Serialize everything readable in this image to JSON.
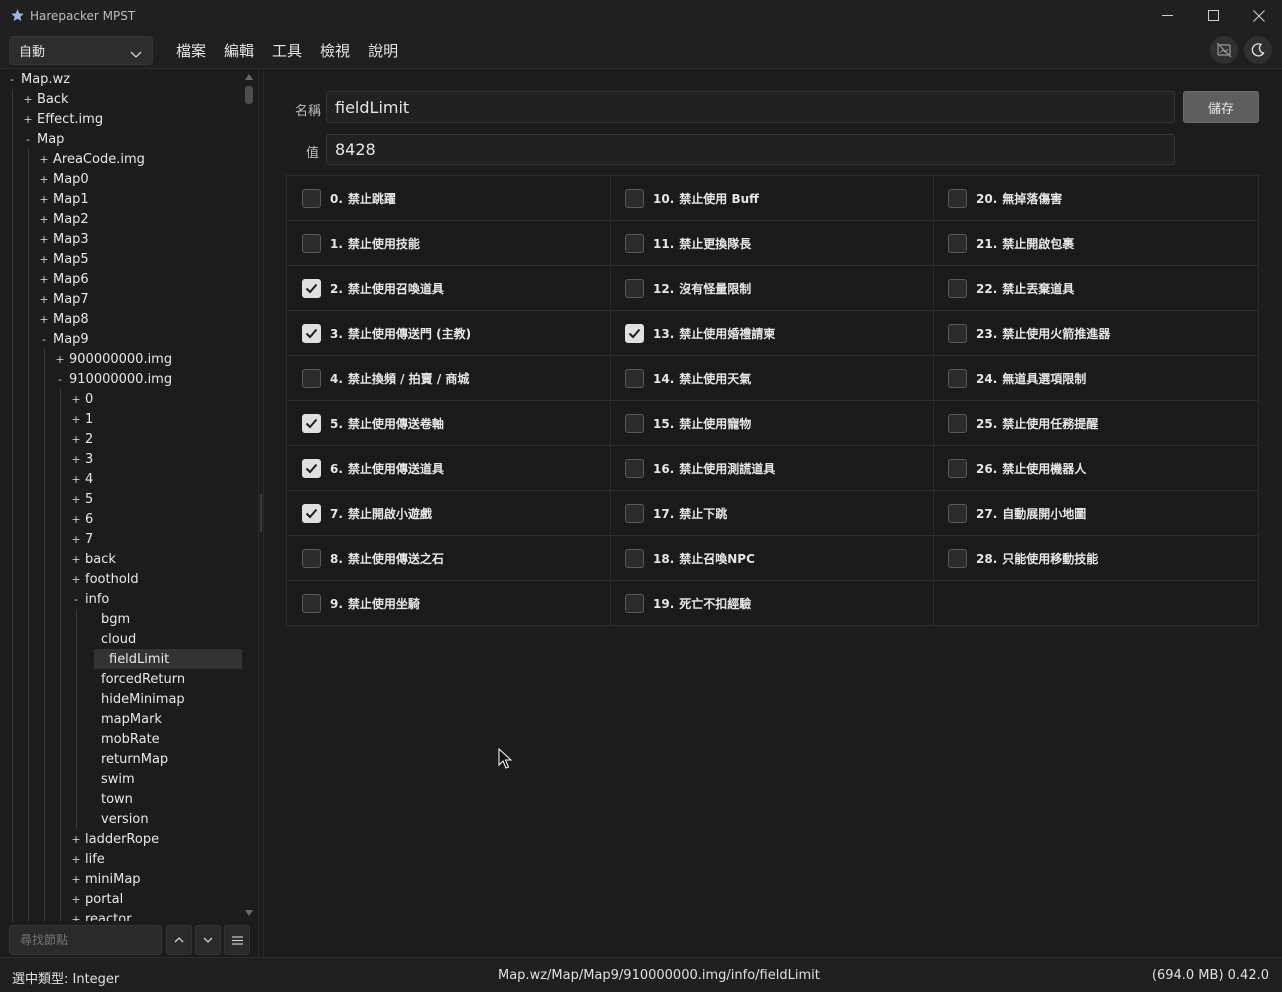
{
  "window": {
    "title": "Harepacker MPST",
    "minimize_icon": "minimize-icon",
    "maximize_icon": "maximize-icon",
    "close_icon": "close-icon"
  },
  "toolbar": {
    "mode_select": {
      "value": "自動"
    },
    "menus": [
      "檔案",
      "編輯",
      "工具",
      "檢視",
      "說明"
    ],
    "right_icons": [
      "image-off-icon",
      "moon-icon"
    ]
  },
  "tree": {
    "items": [
      {
        "label": "Map.wz",
        "expander": "-",
        "level": 0
      },
      {
        "label": "Back",
        "expander": "+",
        "level": 1
      },
      {
        "label": "Effect.img",
        "expander": "+",
        "level": 1
      },
      {
        "label": "Map",
        "expander": "-",
        "level": 1
      },
      {
        "label": "AreaCode.img",
        "expander": "+",
        "level": 2
      },
      {
        "label": "Map0",
        "expander": "+",
        "level": 2
      },
      {
        "label": "Map1",
        "expander": "+",
        "level": 2
      },
      {
        "label": "Map2",
        "expander": "+",
        "level": 2
      },
      {
        "label": "Map3",
        "expander": "+",
        "level": 2
      },
      {
        "label": "Map5",
        "expander": "+",
        "level": 2
      },
      {
        "label": "Map6",
        "expander": "+",
        "level": 2
      },
      {
        "label": "Map7",
        "expander": "+",
        "level": 2
      },
      {
        "label": "Map8",
        "expander": "+",
        "level": 2
      },
      {
        "label": "Map9",
        "expander": "-",
        "level": 2
      },
      {
        "label": "900000000.img",
        "expander": "+",
        "level": 3
      },
      {
        "label": "910000000.img",
        "expander": "-",
        "level": 3
      },
      {
        "label": "0",
        "expander": "+",
        "level": 4
      },
      {
        "label": "1",
        "expander": "+",
        "level": 4
      },
      {
        "label": "2",
        "expander": "+",
        "level": 4
      },
      {
        "label": "3",
        "expander": "+",
        "level": 4
      },
      {
        "label": "4",
        "expander": "+",
        "level": 4
      },
      {
        "label": "5",
        "expander": "+",
        "level": 4
      },
      {
        "label": "6",
        "expander": "+",
        "level": 4
      },
      {
        "label": "7",
        "expander": "+",
        "level": 4
      },
      {
        "label": "back",
        "expander": "+",
        "level": 4
      },
      {
        "label": "foothold",
        "expander": "+",
        "level": 4
      },
      {
        "label": "info",
        "expander": "-",
        "level": 4
      },
      {
        "label": "bgm",
        "expander": "",
        "level": 5
      },
      {
        "label": "cloud",
        "expander": "",
        "level": 5
      },
      {
        "label": "fieldLimit",
        "expander": "",
        "level": 5,
        "selected": true
      },
      {
        "label": "forcedReturn",
        "expander": "",
        "level": 5
      },
      {
        "label": "hideMinimap",
        "expander": "",
        "level": 5
      },
      {
        "label": "mapMark",
        "expander": "",
        "level": 5
      },
      {
        "label": "mobRate",
        "expander": "",
        "level": 5
      },
      {
        "label": "returnMap",
        "expander": "",
        "level": 5
      },
      {
        "label": "swim",
        "expander": "",
        "level": 5
      },
      {
        "label": "town",
        "expander": "",
        "level": 5
      },
      {
        "label": "version",
        "expander": "",
        "level": 5
      },
      {
        "label": "ladderRope",
        "expander": "+",
        "level": 4
      },
      {
        "label": "life",
        "expander": "+",
        "level": 4
      },
      {
        "label": "miniMap",
        "expander": "+",
        "level": 4
      },
      {
        "label": "portal",
        "expander": "+",
        "level": 4
      },
      {
        "label": "reactor",
        "expander": "+",
        "level": 4
      }
    ],
    "search": {
      "placeholder": "尋找節點"
    },
    "search_buttons": [
      "arrow-up-icon",
      "arrow-down-icon",
      "menu-icon"
    ]
  },
  "editor": {
    "name_label": "名稱",
    "name_value": "fieldLimit",
    "value_label": "值",
    "value_value": "8428",
    "save_label": "儲存",
    "flags": [
      {
        "num": "0.",
        "text": "禁止跳躍",
        "checked": false
      },
      {
        "num": "1.",
        "text": "禁止使用技能",
        "checked": false
      },
      {
        "num": "2.",
        "text": "禁止使用召喚道具",
        "checked": true
      },
      {
        "num": "3.",
        "text": "禁止使用傳送門 (主教)",
        "checked": true
      },
      {
        "num": "4.",
        "text": "禁止換頻 / 拍賣 / 商城",
        "checked": false
      },
      {
        "num": "5.",
        "text": "禁止使用傳送卷軸",
        "checked": true
      },
      {
        "num": "6.",
        "text": "禁止使用傳送道具",
        "checked": true
      },
      {
        "num": "7.",
        "text": "禁止開啟小遊戲",
        "checked": true
      },
      {
        "num": "8.",
        "text": "禁止使用傳送之石",
        "checked": false
      },
      {
        "num": "9.",
        "text": "禁止使用坐騎",
        "checked": false
      },
      {
        "num": "10.",
        "text": "禁止使用 Buff",
        "checked": false
      },
      {
        "num": "11.",
        "text": "禁止更換隊長",
        "checked": false
      },
      {
        "num": "12.",
        "text": "沒有怪量限制",
        "checked": false
      },
      {
        "num": "13.",
        "text": "禁止使用婚禮請柬",
        "checked": true
      },
      {
        "num": "14.",
        "text": "禁止使用天氣",
        "checked": false
      },
      {
        "num": "15.",
        "text": "禁止使用寵物",
        "checked": false
      },
      {
        "num": "16.",
        "text": "禁止使用測謊道具",
        "checked": false
      },
      {
        "num": "17.",
        "text": "禁止下跳",
        "checked": false
      },
      {
        "num": "18.",
        "text": "禁止召喚NPC",
        "checked": false
      },
      {
        "num": "19.",
        "text": "死亡不扣經驗",
        "checked": false
      },
      {
        "num": "20.",
        "text": "無掉落傷害",
        "checked": false
      },
      {
        "num": "21.",
        "text": "禁止開啟包裹",
        "checked": false
      },
      {
        "num": "22.",
        "text": "禁止丟棄道具",
        "checked": false
      },
      {
        "num": "23.",
        "text": "禁止使用火箭推進器",
        "checked": false
      },
      {
        "num": "24.",
        "text": "無道具選項限制",
        "checked": false
      },
      {
        "num": "25.",
        "text": "禁止使用任務提醒",
        "checked": false
      },
      {
        "num": "26.",
        "text": "禁止使用機器人",
        "checked": false
      },
      {
        "num": "27.",
        "text": "自動展開小地圖",
        "checked": false
      },
      {
        "num": "28.",
        "text": "只能使用移動技能",
        "checked": false
      }
    ]
  },
  "status": {
    "selected_type": "選中類型: Integer",
    "path": "Map.wz/Map/Map9/910000000.img/info/fieldLimit",
    "memory_version": "(694.0 MB)  0.42.0"
  },
  "colors": {
    "background": "#1c1c1c",
    "selection": "#333333",
    "checkbox_checked": "#e0e0e0"
  }
}
